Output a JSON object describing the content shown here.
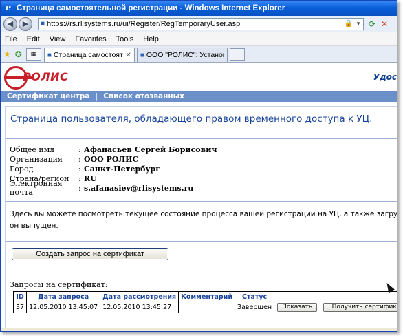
{
  "window": {
    "title": "Страница самостоятельной регистрации - Windows Internet Explorer"
  },
  "address": {
    "url": "https://rs.rlisystems.ru/ui/Register/RegTemporaryUser.asp"
  },
  "menu": [
    "File",
    "Edit",
    "View",
    "Favorites",
    "Tools",
    "Help"
  ],
  "tabs": [
    {
      "label": "Страница самостоятельн...",
      "active": true
    },
    {
      "label": "ООО \"РОЛИС\": Установка с...",
      "active": false
    }
  ],
  "site": {
    "logo_text": "РОЛИС",
    "header_right": "Удос",
    "nav": [
      "Сертификат центра",
      "Список отозванных"
    ]
  },
  "page": {
    "title": "Страница пользователя, обладающего правом временного доступа к УЦ.",
    "fields": [
      {
        "label": "Общее имя",
        "value": "Афанасьев Сергей Борисович"
      },
      {
        "label": "Организация",
        "value": "ООО РОЛИС"
      },
      {
        "label": "Город",
        "value": "Санкт-Петербург"
      },
      {
        "label": "Страна/регион",
        "value": "RU"
      },
      {
        "label": "Электронная почта",
        "value": "s.afanasiev@rlisystems.ru"
      }
    ],
    "description_line1": "Здесь вы можете посмотреть текущее состояние процесса вашей регистрации на УЦ, а также загрузить и устан",
    "description_line2": "он выпущен.",
    "create_button": "Создать запрос на сертификат",
    "requests_caption": "Запросы на сертификат:",
    "table": {
      "headers": [
        "ID",
        "Дата запроса",
        "Дата рассмотрения",
        "Комментарий",
        "Статус",
        ""
      ],
      "rows": [
        {
          "id": "37",
          "request_date": "12.05.2010 13:45:07",
          "review_date": "12.05.2010 13:45:27",
          "comment": "",
          "status": "Завершен",
          "show_button": "Показать",
          "get_button": "Получить сертификат"
        }
      ]
    }
  }
}
